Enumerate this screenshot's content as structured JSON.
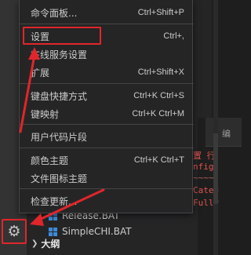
{
  "menu": {
    "items": [
      {
        "label": "命令面板...",
        "shortcut": "Ctrl+Shift+P"
      },
      {
        "label": "设置",
        "shortcut": "Ctrl+,"
      },
      {
        "label": "在线服务设置",
        "shortcut": ""
      },
      {
        "label": "扩展",
        "shortcut": "Ctrl+Shift+X"
      },
      {
        "label": "键盘快捷方式",
        "shortcut": "Ctrl+K Ctrl+S"
      },
      {
        "label": "键映射",
        "shortcut": "Ctrl+K Ctrl+M"
      },
      {
        "label": "用户代码片段",
        "shortcut": ""
      },
      {
        "label": "颜色主题",
        "shortcut": "Ctrl+K Ctrl+T"
      },
      {
        "label": "文件图标主题",
        "shortcut": ""
      },
      {
        "label": "检查更新...",
        "shortcut": ""
      }
    ]
  },
  "explorer": {
    "files": [
      "Release.BAT",
      "SimpleCHI.BAT"
    ],
    "outline_label": "大纲"
  },
  "editor": {
    "tab_label": "编",
    "code_lines": [
      "置 行",
      "nfig",
      "~~~~",
      "Categ",
      "Fully"
    ]
  },
  "colors": {
    "annotation": "#e0262a",
    "menu_bg": "#252526",
    "menu_text": "#cccccc",
    "code_red": "#e0544e"
  },
  "icons": {
    "manage": "gear-icon",
    "file": "windows-file-icon",
    "outline_toggle": "chevron-right-icon"
  }
}
